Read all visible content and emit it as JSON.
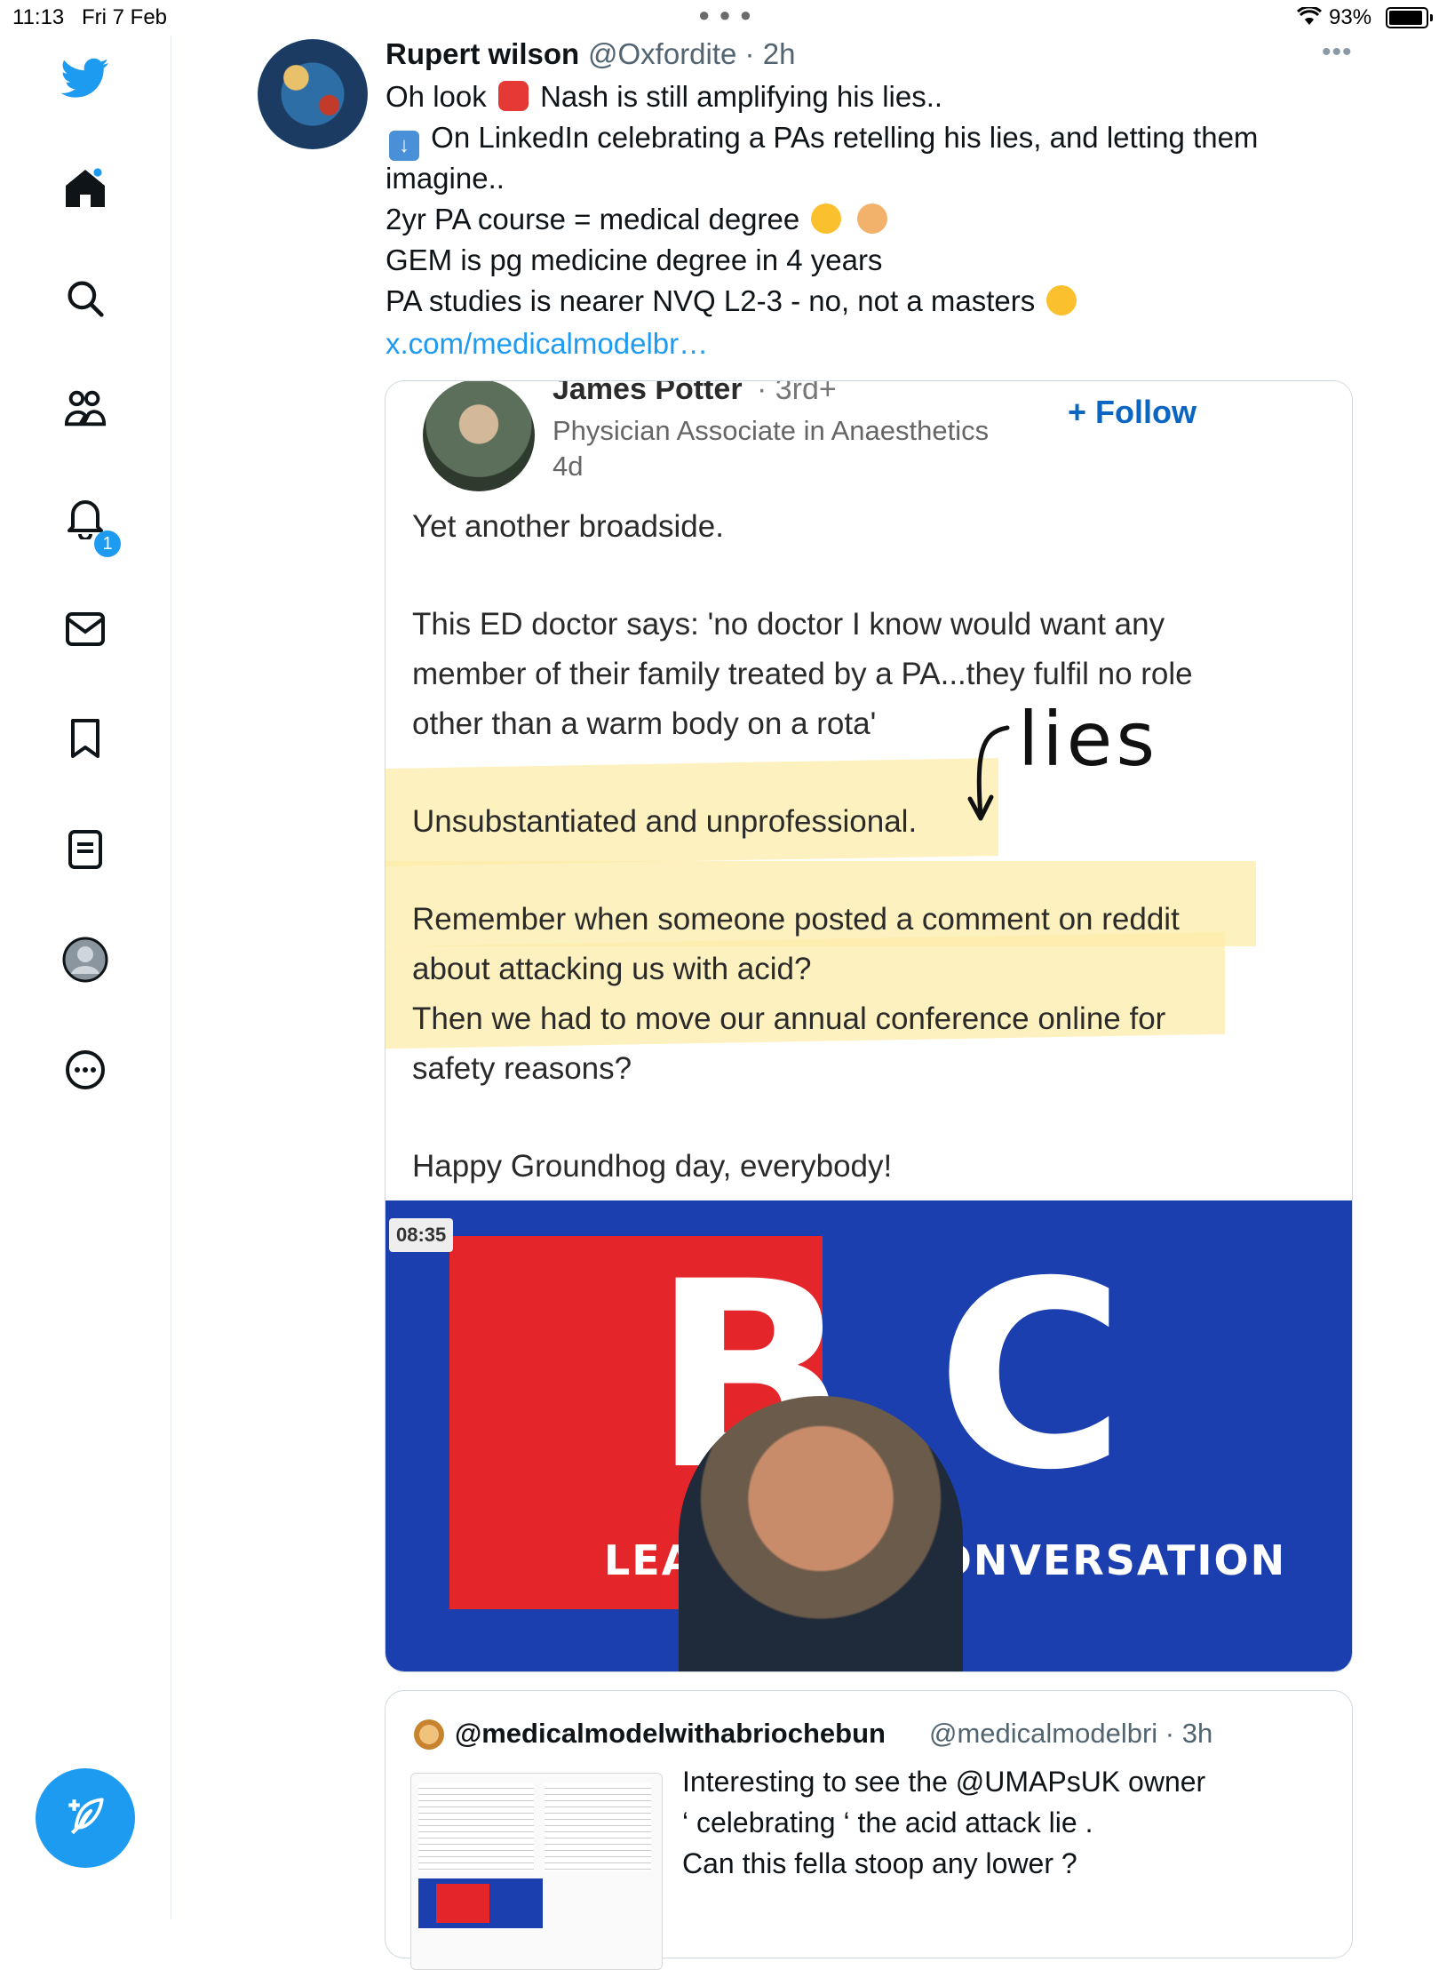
{
  "status_bar": {
    "time": "11:13",
    "date": "Fri 7 Feb",
    "battery_pct": "93%",
    "battery_level": 0.93
  },
  "sidebar": {
    "items": [
      {
        "icon": "twitter-bird-icon"
      },
      {
        "icon": "home-icon"
      },
      {
        "icon": "search-icon"
      },
      {
        "icon": "communities-icon"
      },
      {
        "icon": "notifications-bell-icon",
        "badge": "1"
      },
      {
        "icon": "messages-envelope-icon"
      },
      {
        "icon": "bookmark-icon"
      },
      {
        "icon": "lists-icon"
      },
      {
        "icon": "profile-avatar-icon"
      },
      {
        "icon": "more-circle-icon"
      }
    ],
    "compose_icon": "compose-feather-icon",
    "accent": "#1d9bf0"
  },
  "tweet": {
    "author_name": "Rupert wilson",
    "author_handle": "@Oxfordite · 2h",
    "more_icon": "ellipsis-icon",
    "lines": [
      {
        "before": "Oh look",
        "emoji": "police-light-emoji",
        "after": "Nash is still amplifying his lies.."
      },
      {
        "emoji": "down-arrow-emoji",
        "after": "On LinkedIn celebrating a PAs retelling his lies, and letting them"
      },
      {
        "after": "imagine.."
      },
      {
        "after": "2yr PA course = medical degree",
        "emoji": "laughing-crying-emoji"
      },
      {
        "after": "GEM is pg medicine degree in 4 years"
      },
      {
        "after": "PA studies is nearer NVQ L2-3 - no, not a masters",
        "emoji": "confused-face-emoji"
      }
    ],
    "link": "x.com/medicalmodelbr…"
  },
  "linkedin_post": {
    "name": "James Potter",
    "degree": "· 3rd+",
    "title": "Physician Associate in Anaesthetics",
    "time": "4d",
    "follow_label": "+ Follow",
    "paragraphs": [
      "Yet another broadside.",
      "This ED doctor says: 'no doctor I know would want any",
      "member of their family treated by a PA...they fulfil no role",
      "other than a warm body on a rota'",
      "Unsubstantiated and unprofessional.",
      "Remember when someone posted a comment on reddit",
      "about attacking us with acid?",
      "Then we had to move our annual conference online for",
      "safety reasons?",
      "Happy Groundhog day, everybody!"
    ],
    "annotation": "lies",
    "highlight_color": "#fcecaa"
  },
  "video": {
    "timestamp": "08:35",
    "logo": "LBC",
    "banner_left": "LEA",
    "banner_right": "CONVERSATION"
  },
  "quoted_tweet": {
    "author_name": "@medicalmodelwithabriochebun",
    "author_handle": "@medicalmodelbri · 3h",
    "lines": [
      "Interesting to see the @UMAPsUK owner",
      "‘ celebrating ‘ the acid attack lie .",
      "Can this fella stoop any lower ?"
    ]
  }
}
